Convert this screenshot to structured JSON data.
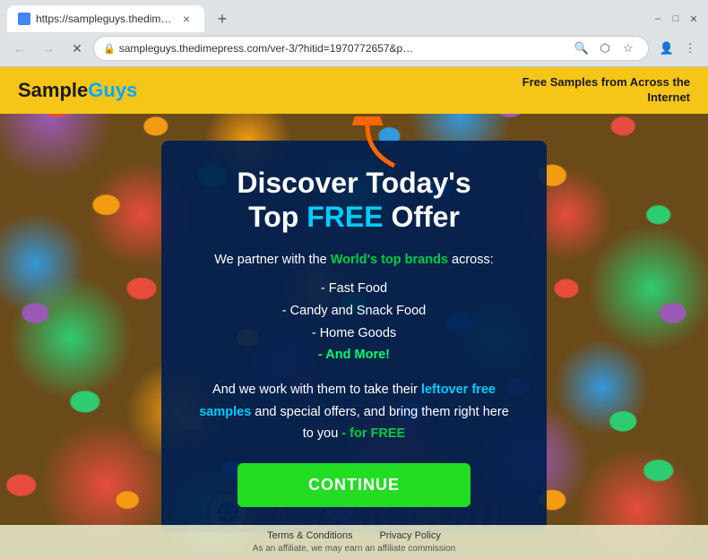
{
  "browser": {
    "tab": {
      "title": "https://sampleguys.thedimepres…",
      "favicon_color": "#4285f4"
    },
    "url": "sampleguys.thedimepress.com/ver-3/?hitid=1970772657&p…",
    "window_controls": {
      "minimize": "–",
      "maximize": "□",
      "close": "✕"
    },
    "nav": {
      "back": "←",
      "forward": "→",
      "reload": "✕"
    }
  },
  "site": {
    "logo_sample": "Sample",
    "logo_guys": "Guys",
    "tagline_line1": "Free Samples from Across the",
    "tagline_line2": "Internet"
  },
  "modal": {
    "title_line1": "Discover Today's",
    "title_line2": "Top ",
    "title_free": "FREE",
    "title_line2_end": " Offer",
    "body_intro": "We partner with the ",
    "body_intro_link": "World's top brands",
    "body_intro_end": " across:",
    "list_items": [
      "- Fast Food",
      "- Candy and Snack Food",
      "- Home Goods",
      "- And More!"
    ],
    "body_para2_start": "And we work with them to take their ",
    "body_para2_link": "leftover free samples",
    "body_para2_mid": " and special offers, and bring them right here to you ",
    "body_para2_end": "- for FREE",
    "continue_button": "CONTINUE"
  },
  "footer": {
    "links": [
      "Terms & Conditions",
      "Privacy Policy"
    ],
    "disclaimer": "As an affiliate, we may earn an affiliate commission"
  },
  "icons": {
    "lock": "🔒",
    "search": "🔍",
    "share": "⬡",
    "star": "☆",
    "person": "👤",
    "menu": "⋮",
    "close_tab": "×"
  }
}
